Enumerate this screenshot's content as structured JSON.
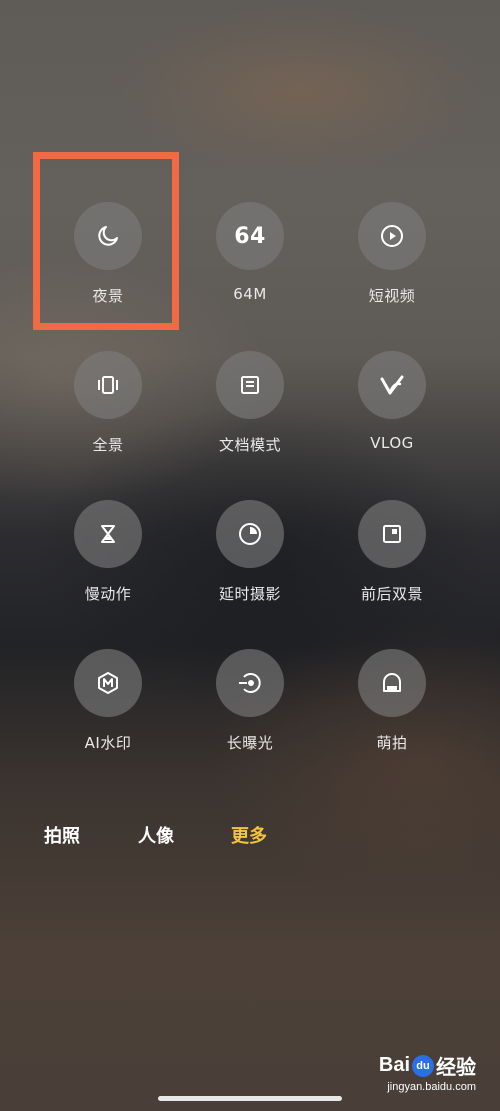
{
  "modes": [
    {
      "label": "夜景",
      "icon": "moon-icon"
    },
    {
      "label": "64M",
      "icon": "64-icon",
      "icon_text": "64"
    },
    {
      "label": "短视频",
      "icon": "play-circle-icon"
    },
    {
      "label": "全景",
      "icon": "panorama-icon"
    },
    {
      "label": "文档模式",
      "icon": "document-icon"
    },
    {
      "label": "VLOG",
      "icon": "vlog-icon"
    },
    {
      "label": "慢动作",
      "icon": "hourglass-icon"
    },
    {
      "label": "延时摄影",
      "icon": "timelapse-icon"
    },
    {
      "label": "前后双景",
      "icon": "dual-view-icon"
    },
    {
      "label": "AI水印",
      "icon": "ai-watermark-icon"
    },
    {
      "label": "长曝光",
      "icon": "long-exposure-icon"
    },
    {
      "label": "萌拍",
      "icon": "cute-shot-icon"
    }
  ],
  "tabs": [
    {
      "label": "拍照",
      "active": false
    },
    {
      "label": "人像",
      "active": false
    },
    {
      "label": "更多",
      "active": true
    }
  ],
  "colors": {
    "highlight_border": "#f26a43",
    "active_tab": "#f5c43d",
    "icon_bg": "#7d7d7d"
  },
  "watermark": {
    "logo_text": "Bai",
    "logo_text2": "经验",
    "url": "jingyan.baidu.com"
  }
}
